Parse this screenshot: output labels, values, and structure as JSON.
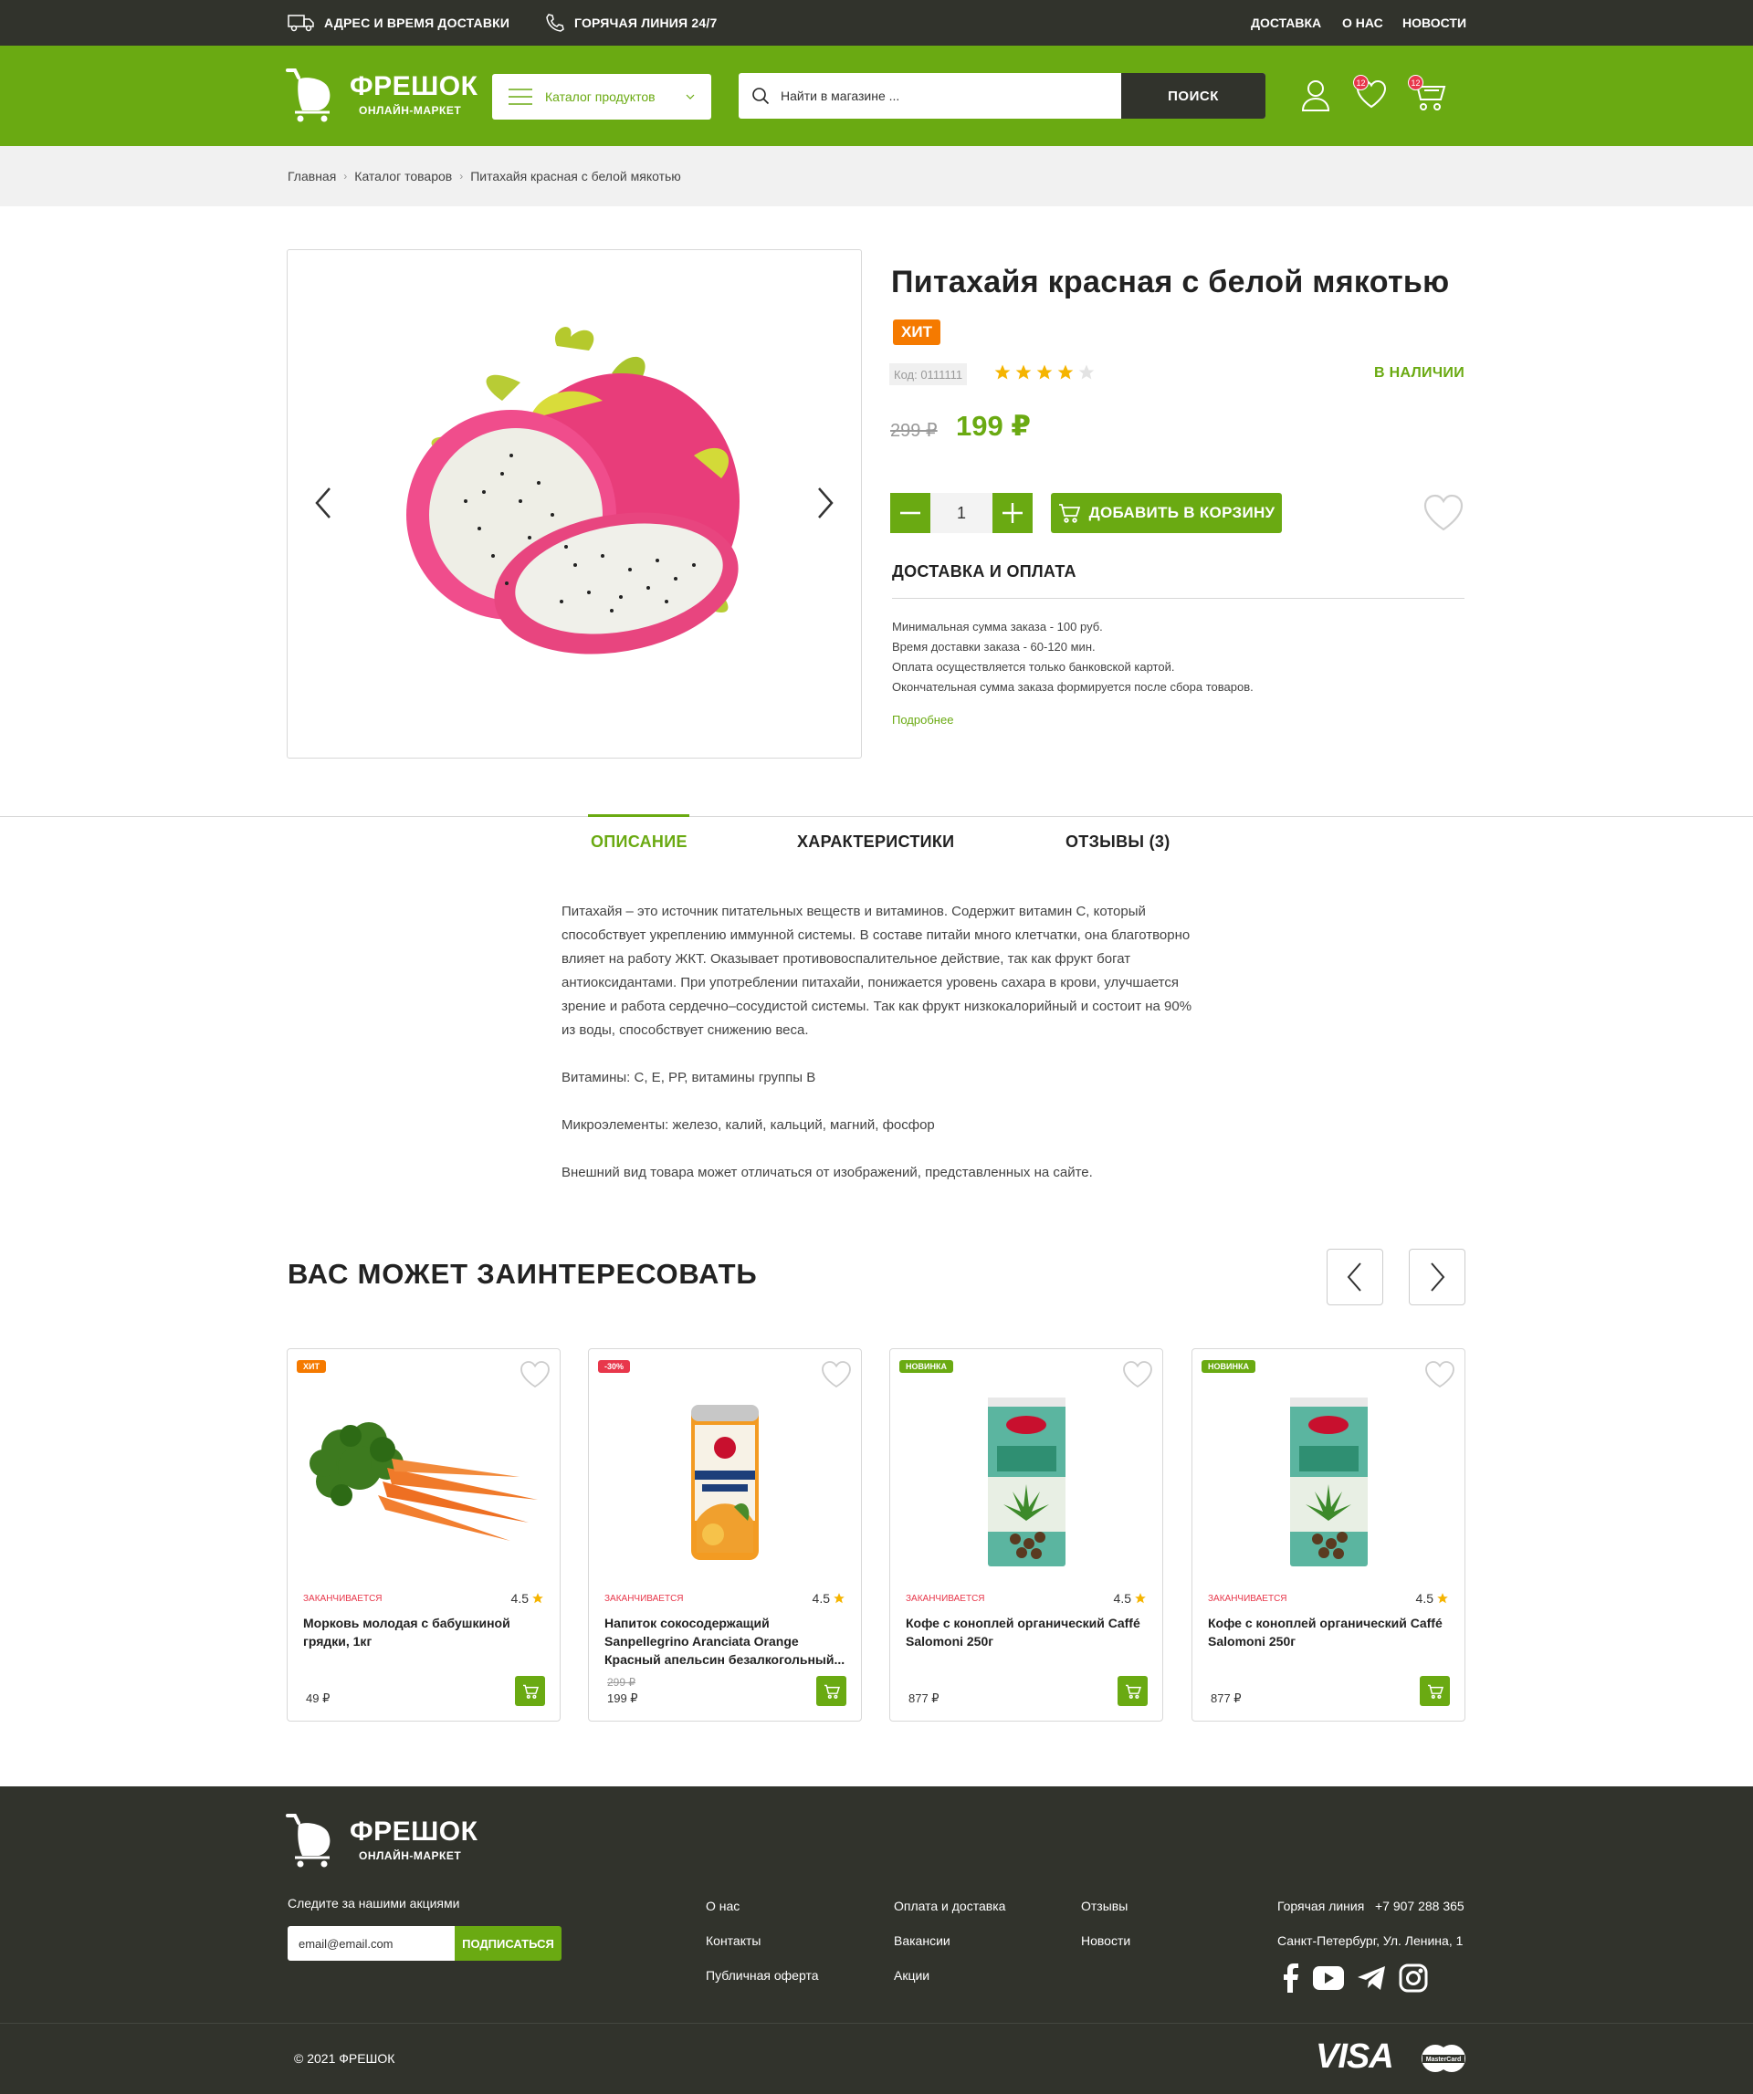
{
  "topbar": {
    "address": "АДРЕС И ВРЕМЯ ДОСТАВКИ",
    "hotline": "ГОРЯЧАЯ ЛИНИЯ 24/7",
    "nav": [
      "ДОСТАВКА",
      "О НАС",
      "НОВОСТИ"
    ]
  },
  "header": {
    "logo_name": "ФРЕШОК",
    "logo_sub": "ОНЛАЙН-МАРКЕТ",
    "catalog": "Каталог продуктов",
    "search_placeholder": "Найти в магазине ...",
    "search_button": "ПОИСК",
    "fav_count": "12",
    "cart_count": "12"
  },
  "breadcrumbs": [
    "Главная",
    "Каталог товаров",
    "Питахайя красная с белой мякотью"
  ],
  "product": {
    "title": "Питахайя красная с белой мякотью",
    "badge": "ХИТ",
    "code": "Код: 0111111",
    "rating": 4,
    "stock": "В НАЛИЧИИ",
    "old_price": "299 ₽",
    "price": "199 ₽",
    "quantity": "1",
    "add_to_cart": "ДОБАВИТЬ В КОРЗИНУ",
    "delivery_title": "ДОСТАВКА И ОПЛАТА",
    "delivery_lines": [
      "Минимальная сумма заказа - 100 руб.",
      "Время доставки заказа - 60-120 мин.",
      "Оплата осуществляется только банковской картой.",
      "Окончательная сумма заказа формируется после сбора товаров."
    ],
    "more": "Подробнее"
  },
  "tabs": [
    "ОПИСАНИЕ",
    "ХАРАКТЕРИСТИКИ",
    "ОТЗЫВЫ (3)"
  ],
  "description": [
    "Питахайя – это источник питательных веществ и витаминов. Содержит витамин С, который способствует укреплению иммунной системы. В составе питайи много клетчатки, она благотворно влияет на работу ЖКТ. Оказывает противовоспалительное действие, так как фрукт богат антиоксидантами. При употреблении питахайи, понижается уровень сахара в крови, улучшается зрение и работа сердечно–сосудистой системы. Так как фрукт низкокалорийный и состоит на 90% из воды, способствует снижению веса.",
    "Витамины: С, Е, РР, витамины группы В",
    "Микроэлементы: железо, калий, кальций, магний, фосфор",
    "Внешний вид товара может отличаться от изображений, представленных на сайте."
  ],
  "related": {
    "title": "ВАС МОЖЕТ ЗАИНТЕРЕСОВАТЬ",
    "cards": [
      {
        "tag": "ХИТ",
        "tag_color": "#f57a00",
        "status": "ЗАКАНЧИВАЕТСЯ",
        "rating": "4.5",
        "name": "Морковь молодая с бабушкиной грядки, 1кг",
        "old_price": "",
        "price": "49 ₽"
      },
      {
        "tag": "-30%",
        "tag_color": "#e8374b",
        "status": "ЗАКАНЧИВАЕТСЯ",
        "rating": "4.5",
        "name": "Напиток сокосодержащий Sanpellegrino Aranciata Orange Красный апельсин безалкогольный...",
        "old_price": "299 ₽",
        "price": "199 ₽"
      },
      {
        "tag": "НОВИНКА",
        "tag_color": "#6aaa12",
        "status": "ЗАКАНЧИВАЕТСЯ",
        "rating": "4.5",
        "name": "Кофе с коноплей органический Caffé Salomoni 250г",
        "old_price": "",
        "price": "877 ₽"
      },
      {
        "tag": "НОВИНКА",
        "tag_color": "#6aaa12",
        "status": "ЗАКАНЧИВАЕТСЯ",
        "rating": "4.5",
        "name": "Кофе с коноплей органический Caffé Salomoni 250г",
        "old_price": "",
        "price": "877 ₽"
      }
    ]
  },
  "footer": {
    "logo_name": "ФРЕШОК",
    "logo_sub": "ОНЛАЙН-МАРКЕТ",
    "follow": "Следите за нашими акциями",
    "email_placeholder": "email@email.com",
    "subscribe": "ПОДПИСАТЬСЯ",
    "col1": [
      "О нас",
      "Контакты",
      "Публичная оферта"
    ],
    "col2": [
      "Оплата и доставка",
      "Вакансии",
      "Акции"
    ],
    "col3": [
      "Отзывы",
      "Новости"
    ],
    "hotline_label": "Горячая линия",
    "hotline_phone": "+7 907 288 365",
    "address": "Санкт-Петербург, Ул. Ленина, 1",
    "copyright": "© 2021 ФРЕШОК",
    "payment": [
      "VISA",
      "MasterCard"
    ]
  },
  "colors": {
    "brand_green": "#6aaa12",
    "dark": "#31332c",
    "hit_orange": "#f57a00",
    "sale_red": "#e8374b",
    "star": "#f5b400"
  }
}
